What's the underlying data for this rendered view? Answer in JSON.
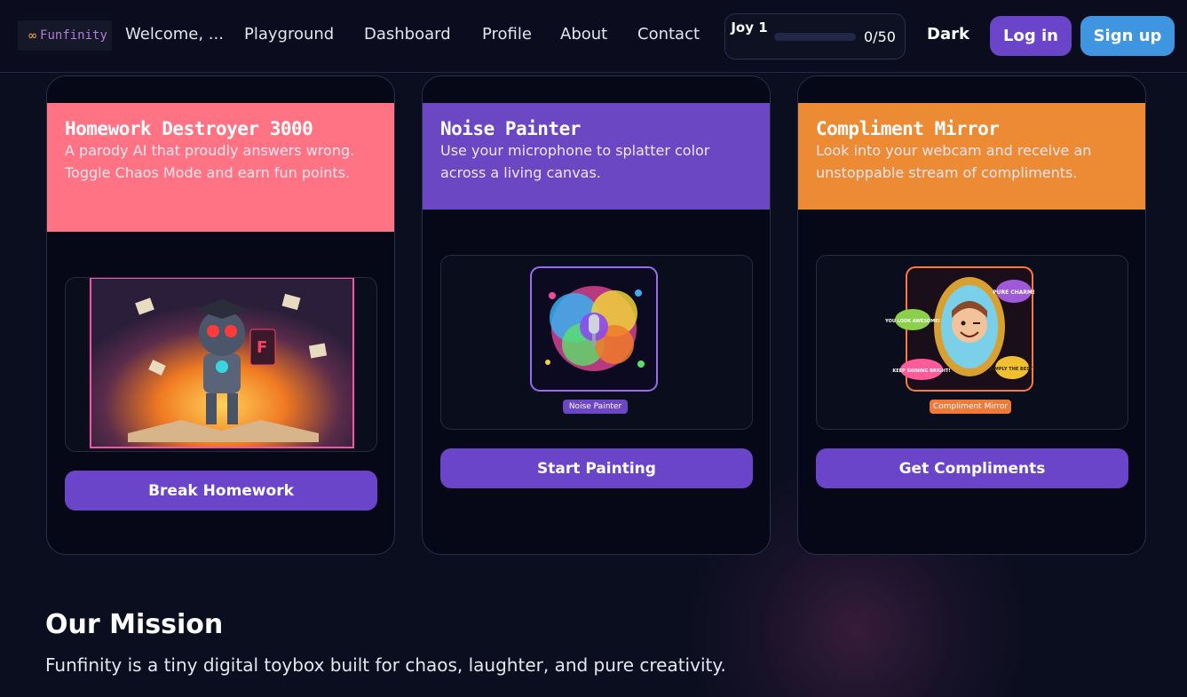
{
  "nav": {
    "logo_text": "Funfinity",
    "logo_icon": "infinity-icon",
    "welcome": "Welcome, ...",
    "links": [
      "Playground",
      "Dashboard",
      "Profile",
      "About",
      "Contact"
    ],
    "joy": {
      "label": "Joy 1",
      "count": "0/50",
      "progress": 0
    },
    "theme_toggle": "Dark",
    "login": "Log in",
    "signup": "Sign up"
  },
  "cards": [
    {
      "title": "Homework Destroyer 3000",
      "description": "A parody AI that proudly answers wrong. Toggle Chaos Mode and earn fun points.",
      "header_color": "#ff7384",
      "button": "Break Homework"
    },
    {
      "title": "Noise Painter",
      "description": "Use your microphone to splatter color across a living canvas.",
      "header_color": "#6b47c4",
      "image_caption": "Noise Painter",
      "button": "Start Painting"
    },
    {
      "title": "Compliment Mirror",
      "description": "Look into your webcam and receive an unstoppable stream of compliments.",
      "header_color": "#ed8a34",
      "image_caption": "Compliment Mirror",
      "bubbles": [
        "PURE CHARM!",
        "YOU LOOK AWESOME!",
        "KEEP SHINING BRIGHT!",
        "SIMPLY THE BEST!"
      ],
      "button": "Get Compliments"
    }
  ],
  "mission": {
    "title": "Our Mission",
    "text": "Funfinity is a tiny digital toybox built for chaos, laughter, and pure creativity."
  },
  "colors": {
    "background": "#0b0e1e",
    "primary_button": "#6b45c9",
    "signup_button": "#3f95e0"
  }
}
